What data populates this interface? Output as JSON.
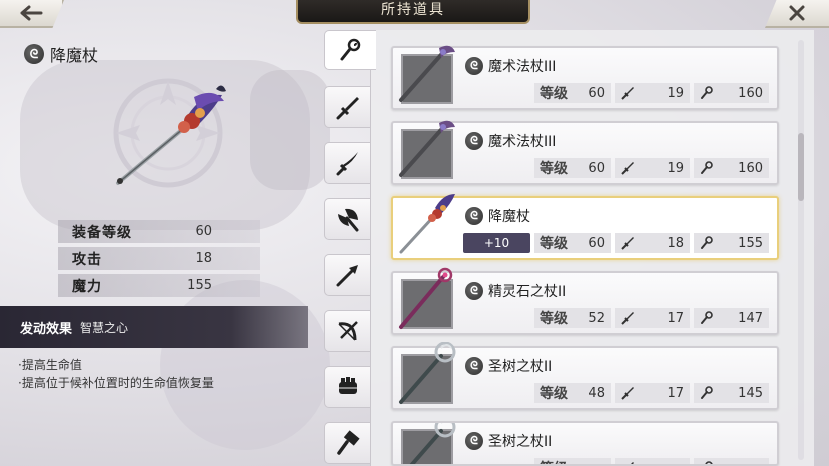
{
  "header": {
    "title": "所持道具",
    "back_icon": "back-arrow-icon",
    "close_icon": "close-icon"
  },
  "detail": {
    "name": "降魔杖",
    "type_icon": "staff-orb-icon",
    "stats": [
      {
        "label": "装备等级",
        "value": "60"
      },
      {
        "label": "攻击",
        "value": "18"
      },
      {
        "label": "魔力",
        "value": "155"
      }
    ],
    "effect": {
      "key": "发动效果",
      "value": "智慧之心"
    },
    "effect_lines": [
      "·提高生命值",
      "·提高位于候补位置时的生命值恢复量"
    ]
  },
  "tabs": [
    "staff-icon",
    "sword-icon",
    "katana-icon",
    "axe-icon",
    "spear-icon",
    "bow-icon",
    "gauntlet-icon",
    "hammer-icon"
  ],
  "items": [
    {
      "name": "魔术法杖III",
      "plus": "",
      "level_label": "等级",
      "level": "60",
      "atk": "19",
      "mag": "160",
      "selected": false
    },
    {
      "name": "魔术法杖III",
      "plus": "",
      "level_label": "等级",
      "level": "60",
      "atk": "19",
      "mag": "160",
      "selected": false
    },
    {
      "name": "降魔杖",
      "plus": "+10",
      "level_label": "等级",
      "level": "60",
      "atk": "18",
      "mag": "155",
      "selected": true
    },
    {
      "name": "精灵石之杖II",
      "plus": "",
      "level_label": "等级",
      "level": "52",
      "atk": "17",
      "mag": "147",
      "selected": false
    },
    {
      "name": "圣树之杖II",
      "plus": "",
      "level_label": "等级",
      "level": "48",
      "atk": "17",
      "mag": "145",
      "selected": false
    },
    {
      "name": "圣树之杖II",
      "plus": "",
      "level_label": "等级",
      "level": "",
      "atk": "",
      "mag": "",
      "selected": false
    }
  ],
  "colors": {
    "selected_border": "#e9cf7c",
    "plus_badge": "#4a4560",
    "effect_bar": "#2a2734"
  }
}
